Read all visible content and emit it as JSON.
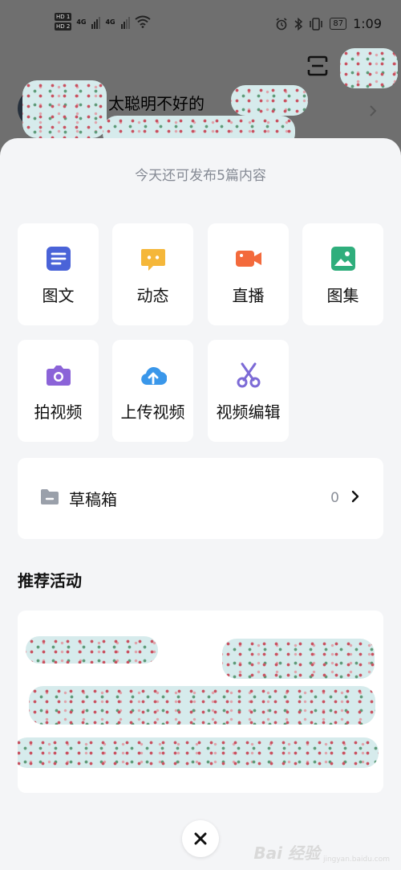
{
  "status_bar": {
    "hd_badge_1": "HD 1",
    "hd_badge_2": "HD 2",
    "net_label_1": "4G",
    "net_label_2": "4G",
    "battery": "87",
    "time": "1:09"
  },
  "header": {
    "username": "太聪明不好的"
  },
  "quota_text": "今天还可发布5篇内容",
  "publish_options": [
    {
      "label": "图文",
      "icon": "article-icon",
      "color": "#4a63d8"
    },
    {
      "label": "动态",
      "icon": "chat-bubble-icon",
      "color": "#f5b73a"
    },
    {
      "label": "直播",
      "icon": "video-camera-icon",
      "color": "#f36a3c"
    },
    {
      "label": "图集",
      "icon": "image-icon",
      "color": "#2fae7c"
    },
    {
      "label": "拍视频",
      "icon": "camera-icon",
      "color": "#8b63d8"
    },
    {
      "label": "上传视频",
      "icon": "cloud-upload-icon",
      "color": "#3a97ea"
    },
    {
      "label": "视频编辑",
      "icon": "scissors-icon",
      "color": "#7c6ad6"
    }
  ],
  "drafts": {
    "label": "草稿箱",
    "count": "0"
  },
  "recommend": {
    "title": "推荐活动"
  },
  "watermark": {
    "main": "Bai 经验",
    "sub": "jingyan.baidu.com"
  }
}
